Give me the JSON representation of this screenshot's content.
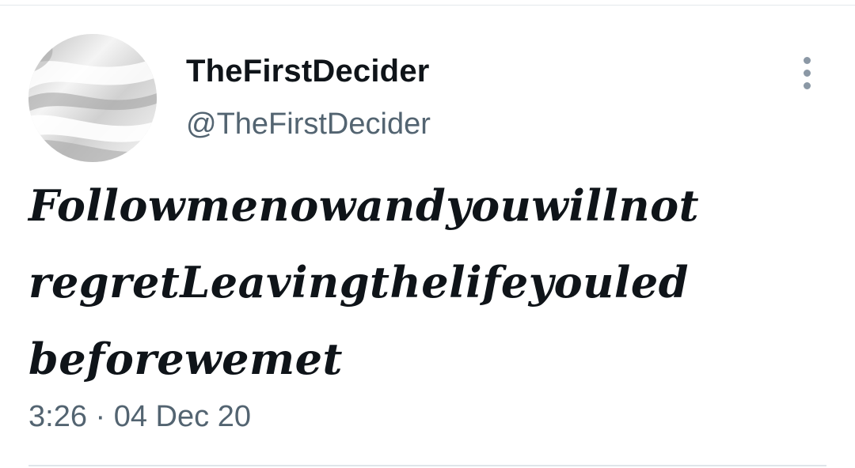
{
  "tweet": {
    "author": {
      "display_name": "TheFirstDecider",
      "handle": "@TheFirstDecider",
      "avatar": "white-silk-fabric-avatar"
    },
    "more_icon": "more-vertical-dots-icon",
    "text": "Followmenowandyouwillnot\nregretLeavingthelifeyouled\nbeforewemet",
    "timestamp": "3:26 · 04 Dec 20"
  },
  "colors": {
    "text_primary": "#0f1419",
    "text_secondary": "#536471",
    "icon": "#8b98a5",
    "divider": "#dfe5ea",
    "background": "#ffffff"
  }
}
